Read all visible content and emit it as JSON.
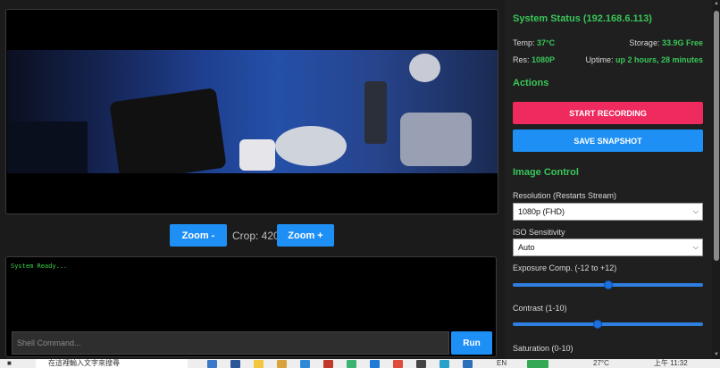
{
  "video": {
    "crop_label": "Crop: 420"
  },
  "zoom": {
    "minus_label": "Zoom -",
    "plus_label": "Zoom +"
  },
  "terminal": {
    "output": "System Ready...",
    "input_placeholder": "Shell Command...",
    "run_label": "Run"
  },
  "status": {
    "title": "System Status (192.168.6.113)",
    "temp_label": "Temp:",
    "temp_value": "37°C",
    "storage_label": "Storage:",
    "storage_value": "33.9G Free",
    "res_label": "Res:",
    "res_value": "1080P",
    "uptime_label": "Uptime:",
    "uptime_value": "up 2 hours, 28 minutes"
  },
  "actions": {
    "title": "Actions",
    "record_label": "START RECORDING",
    "snapshot_label": "SAVE SNAPSHOT"
  },
  "image_control": {
    "title": "Image Control",
    "resolution_label": "Resolution (Restarts Stream)",
    "resolution_value": "1080p (FHD)",
    "iso_label": "ISO Sensitivity",
    "iso_value": "Auto",
    "exposure_label": "Exposure Comp. (-12 to +12)",
    "exposure_value": 0,
    "contrast_label": "Contrast (1-10)",
    "contrast_value": 5,
    "saturation_label": "Saturation (0-10)"
  },
  "taskbar": {
    "search_text": "在這裡輸入文字來搜尋",
    "time": "上午 11:32",
    "temp": "27°C",
    "ime": "EN"
  },
  "colors": {
    "accent_green": "#39c659",
    "accent_blue": "#1e90f5",
    "accent_red": "#ee2a5f"
  }
}
